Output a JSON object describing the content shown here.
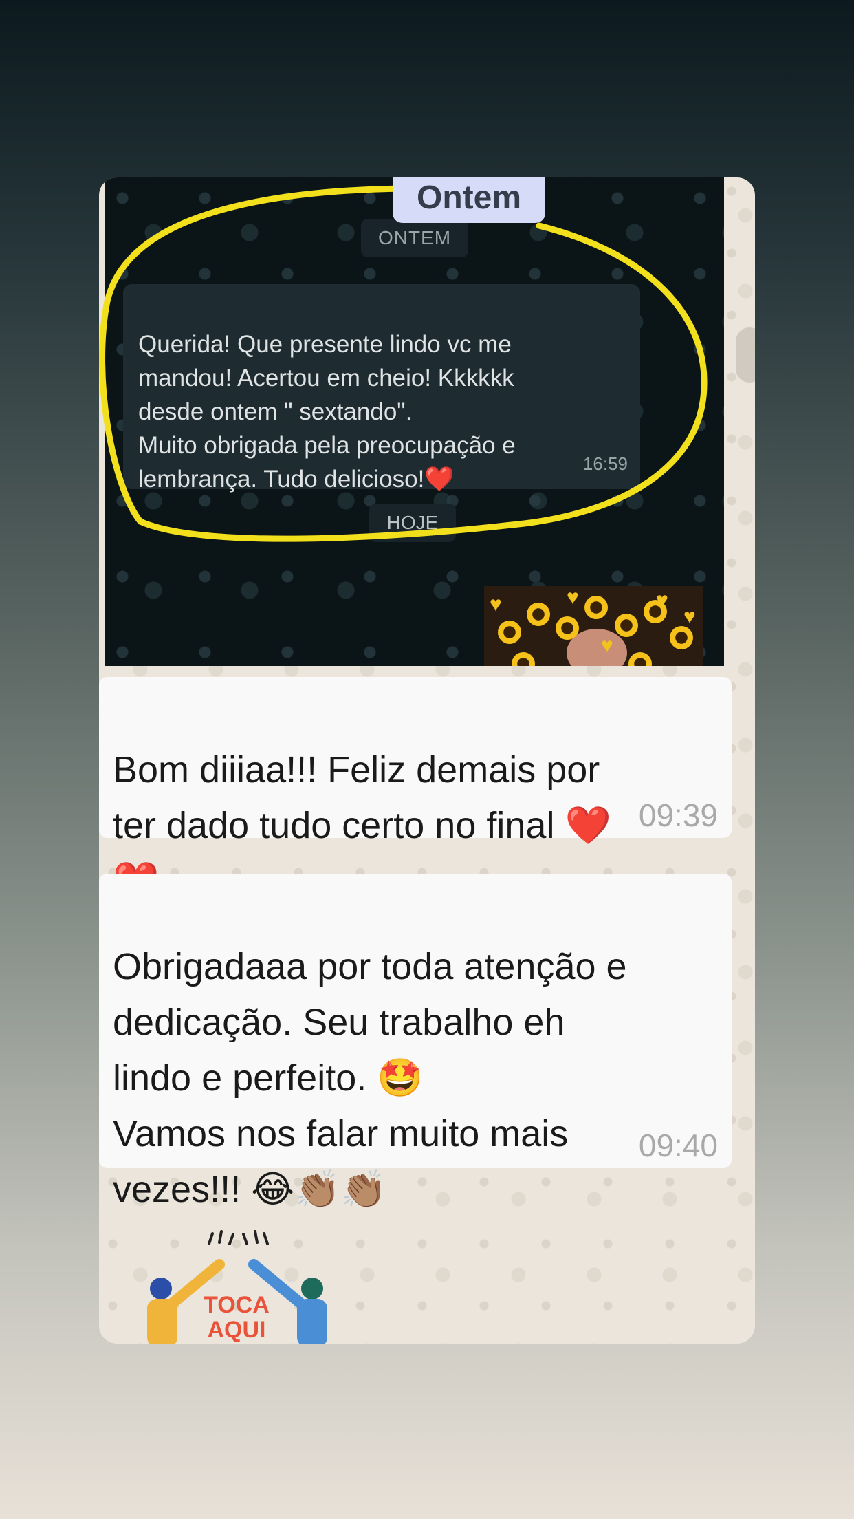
{
  "screenshot": {
    "date_pill_top": "ONTEM",
    "message": "Querida! Que presente lindo vc me\nmandou! Acertou em cheio! Kkkkkk\ndesde ontem \" sextando\".\nMuito obrigada pela preocupação e\nlembrança. Tudo delicioso!❤️",
    "message_time": "16:59",
    "date_pill_bottom": "HOJE"
  },
  "highlight_tag": "Ontem",
  "highlight_color": "#f2e01c",
  "messages": [
    {
      "text": "Bom diiiaa!!! Feliz demais por\nter dado tudo certo no final ❤️\n❤️",
      "time": "09:39"
    },
    {
      "text": "Obrigadaaa por toda atenção e\ndedicação. Seu trabalho eh\nlindo e perfeito.  🤩\nVamos nos falar muito mais\nvezes!!! 😂👏🏽👏🏽",
      "time": "09:40"
    }
  ],
  "sticker": {
    "text_line1": "TOCA",
    "text_line2": "AQUI"
  }
}
